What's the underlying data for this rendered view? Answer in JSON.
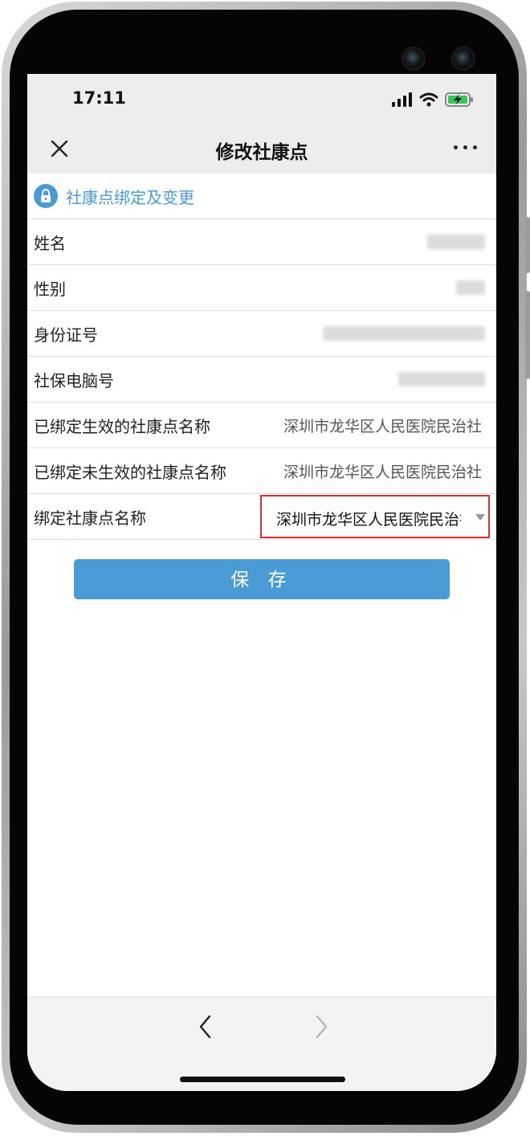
{
  "status_bar": {
    "time": "17:11"
  },
  "nav": {
    "title": "修改社康点"
  },
  "section": {
    "title": "社康点绑定及变更"
  },
  "rows": [
    {
      "label": "姓名",
      "value": ""
    },
    {
      "label": "性别",
      "value": ""
    },
    {
      "label": "身份证号",
      "value": ""
    },
    {
      "label": "社保电脑号",
      "value": ""
    },
    {
      "label": "已绑定生效的社康点名称",
      "value": "深圳市龙华区人民医院民治社"
    },
    {
      "label": "已绑定未生效的社康点名称",
      "value": "深圳市龙华区人民医院民治社"
    },
    {
      "label": "绑定社康点名称",
      "value": "深圳市龙华区人民医院民治社"
    }
  ],
  "save_label": "保 存",
  "colors": {
    "accent": "#4a9ad6",
    "highlight_border": "#d9302c",
    "nav_background": "#ededed"
  },
  "icons": {
    "close": "close-icon",
    "more": "more-icon",
    "lock": "lock-icon",
    "back": "chevron-left-icon",
    "forward": "chevron-right-icon"
  }
}
